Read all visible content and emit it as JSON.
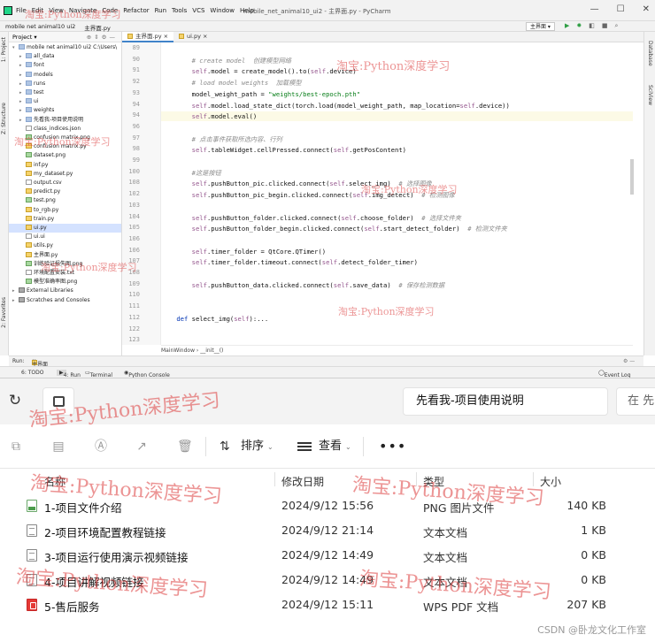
{
  "ide": {
    "menus": [
      "File",
      "Edit",
      "View",
      "Navigate",
      "Code",
      "Refactor",
      "Run",
      "Tools",
      "VCS",
      "Window",
      "Help"
    ],
    "window_title": "mobile_net_animal10_ui2 - 主界面.py - PyCharm",
    "breadcrumb": [
      "mobile net animal10 ui2",
      "主界面.py"
    ],
    "run_config": "主界面",
    "project_label": "Project",
    "left_tool_labels": [
      "1: Project",
      "Z: Structure",
      "2: Favorites"
    ],
    "right_tool_labels": [
      "Database",
      "SciView"
    ],
    "tree": [
      {
        "label": "mobile net animal10 ui2  C:\\Users\\",
        "type": "folder",
        "depth": 0,
        "open": true
      },
      {
        "label": "all_data",
        "type": "folder",
        "depth": 1
      },
      {
        "label": "font",
        "type": "folder",
        "depth": 1
      },
      {
        "label": "models",
        "type": "folder",
        "depth": 1
      },
      {
        "label": "runs",
        "type": "folder",
        "depth": 1
      },
      {
        "label": "test",
        "type": "folder",
        "depth": 1
      },
      {
        "label": "ui",
        "type": "folder",
        "depth": 1
      },
      {
        "label": "weights",
        "type": "folder",
        "depth": 1
      },
      {
        "label": "先看我-项目使用说明",
        "type": "folder",
        "depth": 1
      },
      {
        "label": "class_indices.json",
        "type": "file",
        "depth": 1
      },
      {
        "label": "confusion matrix.png",
        "type": "img",
        "depth": 1
      },
      {
        "label": "confusion matrix.py",
        "type": "py",
        "depth": 1
      },
      {
        "label": "dataset.png",
        "type": "img",
        "depth": 1
      },
      {
        "label": "inf.py",
        "type": "py",
        "depth": 1
      },
      {
        "label": "my_dataset.py",
        "type": "py",
        "depth": 1
      },
      {
        "label": "output.csv",
        "type": "file",
        "depth": 1
      },
      {
        "label": "predict.py",
        "type": "py",
        "depth": 1
      },
      {
        "label": "test.png",
        "type": "img",
        "depth": 1
      },
      {
        "label": "to_rgb.py",
        "type": "py",
        "depth": 1
      },
      {
        "label": "train.py",
        "type": "py",
        "depth": 1
      },
      {
        "label": "ui.py",
        "type": "py",
        "depth": 1,
        "selected": true
      },
      {
        "label": "ui.ui",
        "type": "file",
        "depth": 1
      },
      {
        "label": "utils.py",
        "type": "py",
        "depth": 1
      },
      {
        "label": "主界面.py",
        "type": "py",
        "depth": 1
      },
      {
        "label": "训练验证损失图.png",
        "type": "img",
        "depth": 1
      },
      {
        "label": "环境配置安装.txt",
        "type": "file",
        "depth": 1
      },
      {
        "label": "模型准确率图.png",
        "type": "img",
        "depth": 1
      },
      {
        "label": "External Libraries",
        "type": "lib",
        "depth": 0
      },
      {
        "label": "Scratches and Consoles",
        "type": "lib",
        "depth": 0
      }
    ],
    "tabs": [
      "主界面.py",
      "ui.py"
    ],
    "lines": [
      {
        "n": "89",
        "t": ""
      },
      {
        "n": "90",
        "t": "        # create model  创建模型网络",
        "c": true
      },
      {
        "n": "91",
        "t": "        self.model = create_model().to(self.device)"
      },
      {
        "n": "92",
        "t": "        # load model weights  加载模型",
        "c": true
      },
      {
        "n": "93",
        "t": "        model_weight_path = \"weights/best-epoch.pth\""
      },
      {
        "n": "94",
        "t": "        self.model.load_state_dict(torch.load(model_weight_path, map_location=self.device))"
      },
      {
        "n": "94",
        "t": "        self.model.eval()",
        "hl": true
      },
      {
        "n": "96",
        "t": ""
      },
      {
        "n": "97",
        "t": "        # 点击事件获取所选内容、行列",
        "c": true
      },
      {
        "n": "98",
        "t": "        self.tableWidget.cellPressed.connect(self.getPosContent)"
      },
      {
        "n": "99",
        "t": ""
      },
      {
        "n": "100",
        "t": "        #这是按钮",
        "c": true
      },
      {
        "n": "108",
        "t": "        self.pushButton_pic.clicked.connect(self.select_img)  # 选择图像"
      },
      {
        "n": "102",
        "t": "        self.pushButton_pic_begin.clicked.connect(self.img_detect)  # 检测图像"
      },
      {
        "n": "103",
        "t": ""
      },
      {
        "n": "104",
        "t": "        self.pushButton_folder.clicked.connect(self.choose_folder)  # 选择文件夹"
      },
      {
        "n": "105",
        "t": "        self.pushButton_folder_begin.clicked.connect(self.start_detect_folder)  # 检测文件夹"
      },
      {
        "n": "106",
        "t": ""
      },
      {
        "n": "106",
        "t": "        self.timer_folder = QtCore.QTimer()"
      },
      {
        "n": "107",
        "t": "        self.timer_folder.timeout.connect(self.detect_folder_timer)"
      },
      {
        "n": "108",
        "t": ""
      },
      {
        "n": "109",
        "t": "        self.pushButton_data.clicked.connect(self.save_data)  # 保存检测数据"
      },
      {
        "n": "110",
        "t": ""
      },
      {
        "n": "111",
        "t": ""
      },
      {
        "n": "112",
        "t": "    def select_img(self):..."
      },
      {
        "n": "122",
        "t": ""
      },
      {
        "n": "123",
        "t": ""
      }
    ],
    "editor_breadcrumb": [
      "MainWindow",
      "__init__()"
    ],
    "run_label": "Run:",
    "run_tab": "主界面",
    "status_tabs": [
      "6: TODO",
      "4: Run",
      "Terminal",
      "Python Console"
    ],
    "event_log": "Event Log"
  },
  "explorer": {
    "location": "先看我-项目使用说明",
    "search_placeholder": "在 先",
    "sort_label": "排序",
    "view_label": "查看",
    "more_label": "•••",
    "columns": {
      "name": "名称",
      "date": "修改日期",
      "type": "类型",
      "size": "大小"
    },
    "files": [
      {
        "name": "1-项目文件介绍",
        "date": "2024/9/12 15:56",
        "type": "PNG 图片文件",
        "size": "140 KB",
        "icon": "png"
      },
      {
        "name": "2-项目环境配置教程链接",
        "date": "2024/9/12 21:14",
        "type": "文本文档",
        "size": "1 KB",
        "icon": "txt"
      },
      {
        "name": "3-项目运行使用演示视频链接",
        "date": "2024/9/12 14:49",
        "type": "文本文档",
        "size": "0 KB",
        "icon": "txt"
      },
      {
        "name": "4-项目讲解视频链接",
        "date": "2024/9/12 14:49",
        "type": "文本文档",
        "size": "0 KB",
        "icon": "txt"
      },
      {
        "name": "5-售后服务",
        "date": "2024/9/12 15:11",
        "type": "WPS PDF 文档",
        "size": "207 KB",
        "icon": "pdf"
      }
    ],
    "footer_watermark": "CSDN @卧龙文化工作室"
  },
  "watermark_text": "淘宝:Python深度学习",
  "colors": {
    "accent": "#4083c9",
    "watermark": "#dc3c3c",
    "run_green": "#2f9e44"
  }
}
